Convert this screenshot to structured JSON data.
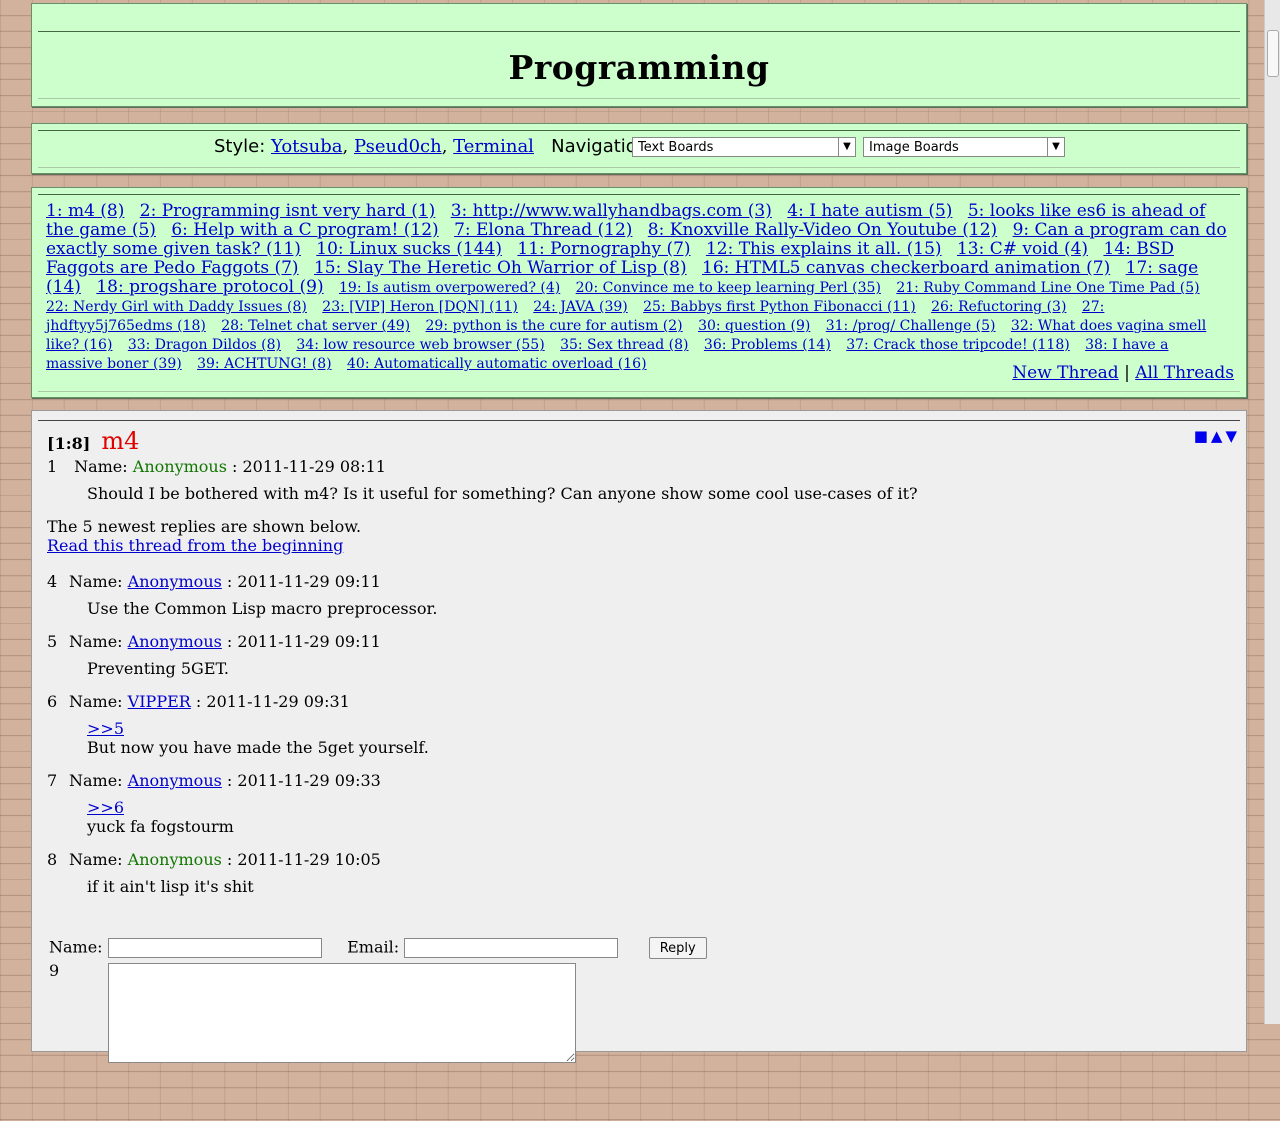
{
  "title": "Programming",
  "nav": {
    "style_label": "Style:",
    "styles": [
      "Yotsuba",
      "Pseud0ch",
      "Terminal"
    ],
    "navigation_label": "Navigation:",
    "select1": "Text Boards",
    "select2": "Image Boards"
  },
  "threads": [
    {
      "t": "1: m4 (8)"
    },
    {
      "t": "2: Programming isnt very hard (1)"
    },
    {
      "t": "3: http://www.wallyhandbags.com (3)"
    },
    {
      "t": "4: I hate autism (5)"
    },
    {
      "t": "5: looks like es6 is ahead of the game (5)"
    },
    {
      "t": "6: Help with a C program! (12)"
    },
    {
      "t": "7: Elona Thread (12)"
    },
    {
      "t": "8: Knoxville Rally-Video On Youtube (12)"
    },
    {
      "t": "9: Can a program can do exactly some given task? (11)"
    },
    {
      "t": "10: Linux sucks (144)"
    },
    {
      "t": "11: Pornography (7)"
    },
    {
      "t": "12: This explains it all. (15)"
    },
    {
      "t": "13: C# void (4)"
    },
    {
      "t": "14: BSD Faggots are Pedo Faggots (7)"
    },
    {
      "t": "15: Slay The Heretic Oh Warrior of Lisp (8)"
    },
    {
      "t": "16: HTML5 canvas checkerboard animation (7)"
    },
    {
      "t": "17: sage (14)"
    },
    {
      "t": "18: progshare protocol (9)"
    }
  ],
  "threads_small": [
    {
      "t": "19: Is autism overpowered? (4)"
    },
    {
      "t": "20: Convince me to keep learning Perl (35)"
    },
    {
      "t": "21: Ruby Command Line One Time Pad (5)"
    },
    {
      "t": "22: Nerdy Girl with Daddy Issues (8)"
    },
    {
      "t": "23: [VIP] Heron [DQN] (11)"
    },
    {
      "t": "24: JAVA (39)"
    },
    {
      "t": "25: Babbys first Python Fibonacci (11)"
    },
    {
      "t": "26: Refuctoring (3)"
    },
    {
      "t": "27: jhdftyy5j765edms (18)"
    },
    {
      "t": "28: Telnet chat server (49)"
    },
    {
      "t": "29: python is the cure for autism (2)"
    },
    {
      "t": "30: question (9)"
    },
    {
      "t": "31: /prog/ Challenge (5)"
    },
    {
      "t": "32: What does vagina smell like? (16)"
    },
    {
      "t": "33: Dragon Dildos (8)"
    },
    {
      "t": "34: low resource web browser (55)"
    },
    {
      "t": "35: Sex thread (8)"
    },
    {
      "t": "36: Problems (14)"
    },
    {
      "t": "37: Crack those tripcode! (118)"
    },
    {
      "t": "38: I have a massive boner (39)"
    },
    {
      "t": "39: ACHTUNG! (8)"
    },
    {
      "t": "40: Automatically automatic overload (16)"
    }
  ],
  "actions": {
    "new_thread": "New Thread",
    "separator": "|",
    "all_threads": "All Threads"
  },
  "thread": {
    "num": "[1:8]",
    "title": "m4",
    "ctrl_icons": "■ ▲ ▼",
    "op": {
      "num": "1",
      "name_label": "Name:",
      "name": "Anonymous",
      "date": ": 2011-11-29 08:11",
      "body": "Should I be bothered with m4? Is it useful for something? Can anyone show some cool use-cases of it?"
    },
    "omitted_text": "The 5 newest replies are shown below.",
    "read_link": "Read this thread from the beginning",
    "replies": [
      {
        "num": "4",
        "name": "Anonymous",
        "link": true,
        "date": ": 2011-11-29 09:11",
        "quote": "",
        "body": "Use the Common Lisp macro preprocessor."
      },
      {
        "num": "5",
        "name": "Anonymous",
        "link": true,
        "date": ": 2011-11-29 09:11",
        "quote": "",
        "body": "Preventing 5GET."
      },
      {
        "num": "6",
        "name": "VIPPER",
        "link": true,
        "date": ": 2011-11-29 09:31",
        "quote": ">>5",
        "body": "But now you have made the 5get yourself."
      },
      {
        "num": "7",
        "name": "Anonymous",
        "link": true,
        "date": ": 2011-11-29 09:33",
        "quote": ">>6",
        "body": "yuck fa fogstourm"
      },
      {
        "num": "8",
        "name": "Anonymous",
        "link": false,
        "date": ": 2011-11-29 10:05",
        "quote": "",
        "body": "if it ain't lisp it's shit"
      }
    ]
  },
  "reply_form": {
    "name_label": "Name:",
    "email_label": "Email:",
    "button": "Reply",
    "next_num": "9"
  }
}
